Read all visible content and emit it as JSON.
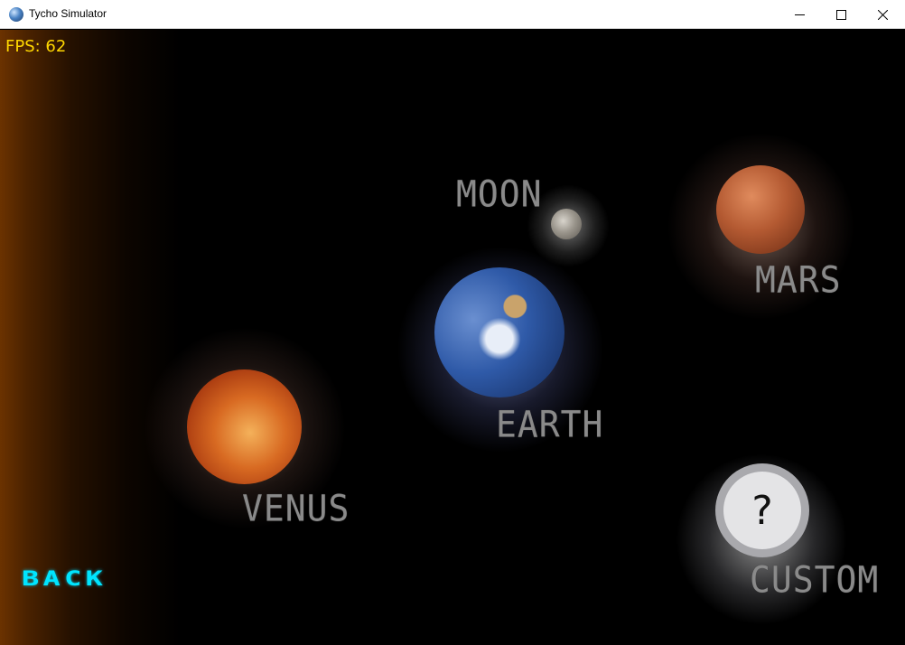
{
  "window": {
    "title": "Tycho Simulator",
    "icon": "planet-app-icon",
    "controls": {
      "minimize_icon": "minimize-icon",
      "maximize_icon": "maximize-icon",
      "close_icon": "close-icon"
    }
  },
  "hud": {
    "fps": "FPS: 62",
    "fps_color": "#ffd700"
  },
  "planets": {
    "moon": {
      "label": "MOON"
    },
    "earth": {
      "label": "EARTH"
    },
    "mars": {
      "label": "MARS"
    },
    "venus": {
      "label": "VENUS"
    },
    "custom": {
      "label": "CUSTOM",
      "symbol": "?"
    }
  },
  "nav": {
    "back_label": "BACK",
    "back_color": "#00e5ff"
  },
  "colors": {
    "label_gray": "#8a8a8a",
    "background": "#000000"
  }
}
